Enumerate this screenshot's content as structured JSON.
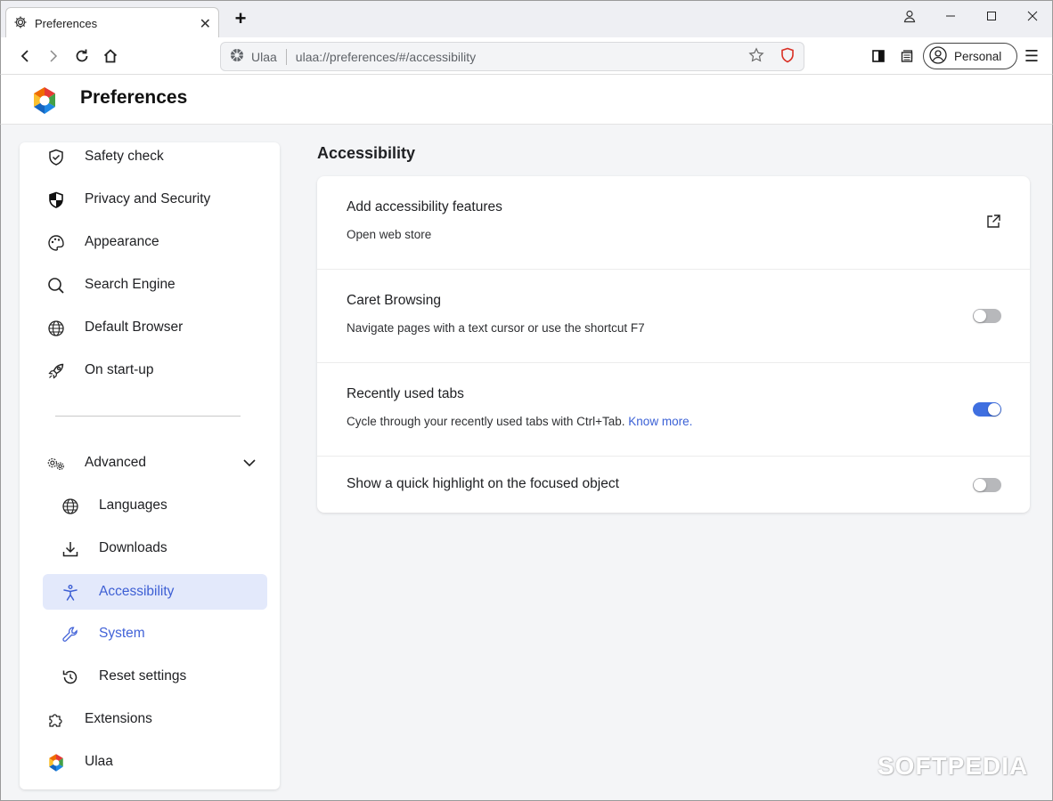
{
  "tab": {
    "title": "Preferences",
    "close": "✕",
    "new_tab": "+"
  },
  "window": {
    "minimize": "—",
    "maximize": "☐",
    "close": "✕"
  },
  "toolbar": {
    "site_label": "Ulaa",
    "url": "ulaa://preferences/#/accessibility",
    "profile_label": "Personal",
    "menu": "☰"
  },
  "header": {
    "title": "Preferences"
  },
  "sidebar": {
    "items": [
      {
        "label": "Safety check",
        "icon": "shield-check-icon"
      },
      {
        "label": "Privacy and Security",
        "icon": "shield-half-icon"
      },
      {
        "label": "Appearance",
        "icon": "palette-icon"
      },
      {
        "label": "Search Engine",
        "icon": "search-icon"
      },
      {
        "label": "Default Browser",
        "icon": "globe-icon"
      },
      {
        "label": "On start-up",
        "icon": "rocket-icon"
      }
    ],
    "advanced": {
      "label": "Advanced",
      "icon": "gears-icon",
      "expanded": true
    },
    "sub_items": [
      {
        "label": "Languages",
        "icon": "globe-icon"
      },
      {
        "label": "Downloads",
        "icon": "download-icon"
      },
      {
        "label": "Accessibility",
        "icon": "accessibility-icon",
        "active": true
      },
      {
        "label": "System",
        "icon": "wrench-icon"
      },
      {
        "label": "Reset settings",
        "icon": "reset-icon"
      }
    ],
    "bottom_items": [
      {
        "label": "Extensions",
        "icon": "puzzle-icon"
      },
      {
        "label": "Ulaa",
        "icon": "ulaa-logo-icon"
      }
    ]
  },
  "main": {
    "section_title": "Accessibility",
    "rows": [
      {
        "title": "Add accessibility features",
        "subtitle": "Open web store",
        "control": "external-link"
      },
      {
        "title": "Caret Browsing",
        "subtitle": "Navigate pages with a text cursor or use the shortcut F7",
        "control": "toggle",
        "on": false
      },
      {
        "title": "Recently used tabs",
        "subtitle": "Cycle through your recently used tabs with Ctrl+Tab.",
        "link": "Know more.",
        "control": "toggle",
        "on": true
      },
      {
        "title": "Show a quick highlight on the focused object",
        "control": "toggle",
        "on": false
      }
    ]
  },
  "colors": {
    "accent": "#3f6fe0",
    "active_bg": "#e3e9fb",
    "page_bg": "#f4f5f7"
  },
  "watermark": "SOFTPEDIA"
}
